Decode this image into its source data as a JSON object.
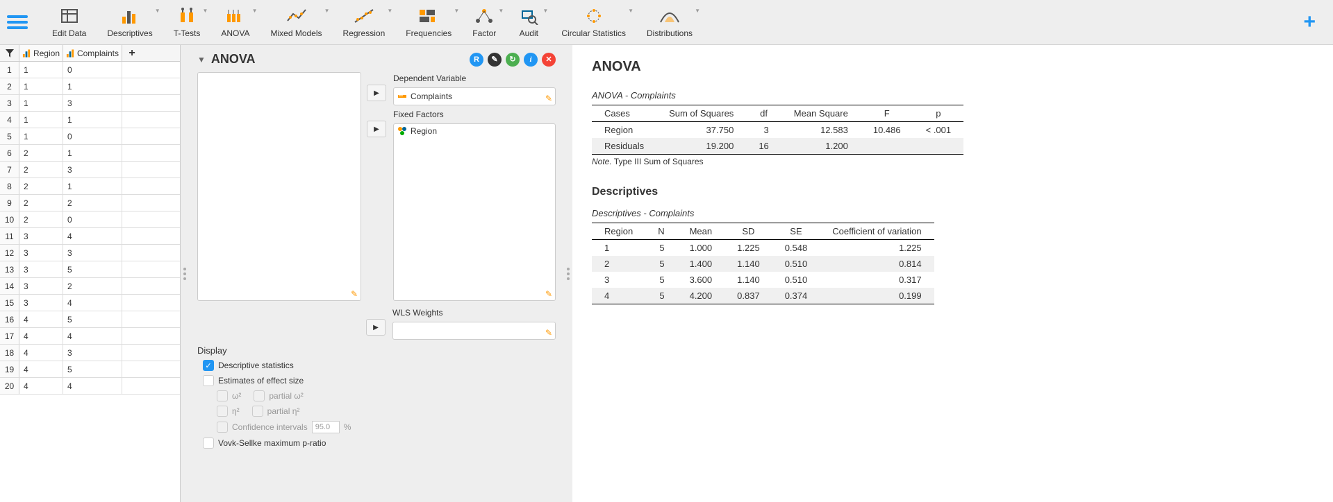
{
  "toolbar": {
    "items": [
      {
        "label": "Edit Data",
        "dropdown": false
      },
      {
        "label": "Descriptives",
        "dropdown": true
      },
      {
        "label": "T-Tests",
        "dropdown": true
      },
      {
        "label": "ANOVA",
        "dropdown": true
      },
      {
        "label": "Mixed Models",
        "dropdown": true
      },
      {
        "label": "Regression",
        "dropdown": true
      },
      {
        "label": "Frequencies",
        "dropdown": true
      },
      {
        "label": "Factor",
        "dropdown": true
      },
      {
        "label": "Audit",
        "dropdown": true
      },
      {
        "label": "Circular Statistics",
        "dropdown": true
      },
      {
        "label": "Distributions",
        "dropdown": true
      }
    ]
  },
  "data": {
    "columns": [
      {
        "name": "Region"
      },
      {
        "name": "Complaints"
      }
    ],
    "rows": [
      {
        "n": "1",
        "r": "1",
        "c": "0"
      },
      {
        "n": "2",
        "r": "1",
        "c": "1"
      },
      {
        "n": "3",
        "r": "1",
        "c": "3"
      },
      {
        "n": "4",
        "r": "1",
        "c": "1"
      },
      {
        "n": "5",
        "r": "1",
        "c": "0"
      },
      {
        "n": "6",
        "r": "2",
        "c": "1"
      },
      {
        "n": "7",
        "r": "2",
        "c": "3"
      },
      {
        "n": "8",
        "r": "2",
        "c": "1"
      },
      {
        "n": "9",
        "r": "2",
        "c": "2"
      },
      {
        "n": "10",
        "r": "2",
        "c": "0"
      },
      {
        "n": "11",
        "r": "3",
        "c": "4"
      },
      {
        "n": "12",
        "r": "3",
        "c": "3"
      },
      {
        "n": "13",
        "r": "3",
        "c": "5"
      },
      {
        "n": "14",
        "r": "3",
        "c": "2"
      },
      {
        "n": "15",
        "r": "3",
        "c": "4"
      },
      {
        "n": "16",
        "r": "4",
        "c": "5"
      },
      {
        "n": "17",
        "r": "4",
        "c": "4"
      },
      {
        "n": "18",
        "r": "4",
        "c": "3"
      },
      {
        "n": "19",
        "r": "4",
        "c": "5"
      },
      {
        "n": "20",
        "r": "4",
        "c": "4"
      }
    ]
  },
  "options": {
    "title": "ANOVA",
    "dep_var_label": "Dependent Variable",
    "dep_var_value": "Complaints",
    "fixed_factors_label": "Fixed Factors",
    "fixed_factors_value": "Region",
    "wls_label": "WLS Weights",
    "display": {
      "title": "Display",
      "descriptive": "Descriptive statistics",
      "effect_size": "Estimates of effect size",
      "omega": "ω²",
      "partial_omega": "partial ω²",
      "eta": "η²",
      "partial_eta": "partial η²",
      "ci_label": "Confidence intervals",
      "ci_value": "95.0",
      "ci_pct": "%",
      "vovk": "Vovk-Sellke maximum p-ratio"
    }
  },
  "results": {
    "title": "ANOVA",
    "anova_sub": "ANOVA - Complaints",
    "anova_headers": [
      "Cases",
      "Sum of Squares",
      "df",
      "Mean Square",
      "F",
      "p"
    ],
    "anova_rows": [
      {
        "cases": "Region",
        "ss": "37.750",
        "df": "3",
        "ms": "12.583",
        "f": "10.486",
        "p": "< .001",
        "stripe": false
      },
      {
        "cases": "Residuals",
        "ss": "19.200",
        "df": "16",
        "ms": "1.200",
        "f": "",
        "p": "",
        "stripe": true
      }
    ],
    "anova_note_prefix": "Note.",
    "anova_note": " Type III Sum of Squares",
    "desc_title": "Descriptives",
    "desc_sub": "Descriptives - Complaints",
    "desc_headers": [
      "Region",
      "N",
      "Mean",
      "SD",
      "SE",
      "Coefficient of variation"
    ],
    "desc_rows": [
      {
        "region": "1",
        "n": "5",
        "mean": "1.000",
        "sd": "1.225",
        "se": "0.548",
        "cov": "1.225",
        "stripe": false
      },
      {
        "region": "2",
        "n": "5",
        "mean": "1.400",
        "sd": "1.140",
        "se": "0.510",
        "cov": "0.814",
        "stripe": true
      },
      {
        "region": "3",
        "n": "5",
        "mean": "3.600",
        "sd": "1.140",
        "se": "0.510",
        "cov": "0.317",
        "stripe": false
      },
      {
        "region": "4",
        "n": "5",
        "mean": "4.200",
        "sd": "0.837",
        "se": "0.374",
        "cov": "0.199",
        "stripe": true
      }
    ]
  },
  "chart_data": [
    {
      "type": "table",
      "title": "ANOVA - Complaints",
      "columns": [
        "Cases",
        "Sum of Squares",
        "df",
        "Mean Square",
        "F",
        "p"
      ],
      "rows": [
        [
          "Region",
          37.75,
          3,
          12.583,
          10.486,
          "< .001"
        ],
        [
          "Residuals",
          19.2,
          16,
          1.2,
          null,
          null
        ]
      ],
      "note": "Type III Sum of Squares"
    },
    {
      "type": "table",
      "title": "Descriptives - Complaints",
      "columns": [
        "Region",
        "N",
        "Mean",
        "SD",
        "SE",
        "Coefficient of variation"
      ],
      "rows": [
        [
          "1",
          5,
          1.0,
          1.225,
          0.548,
          1.225
        ],
        [
          "2",
          5,
          1.4,
          1.14,
          0.51,
          0.814
        ],
        [
          "3",
          5,
          3.6,
          1.14,
          0.51,
          0.317
        ],
        [
          "4",
          5,
          4.2,
          0.837,
          0.374,
          0.199
        ]
      ]
    }
  ]
}
